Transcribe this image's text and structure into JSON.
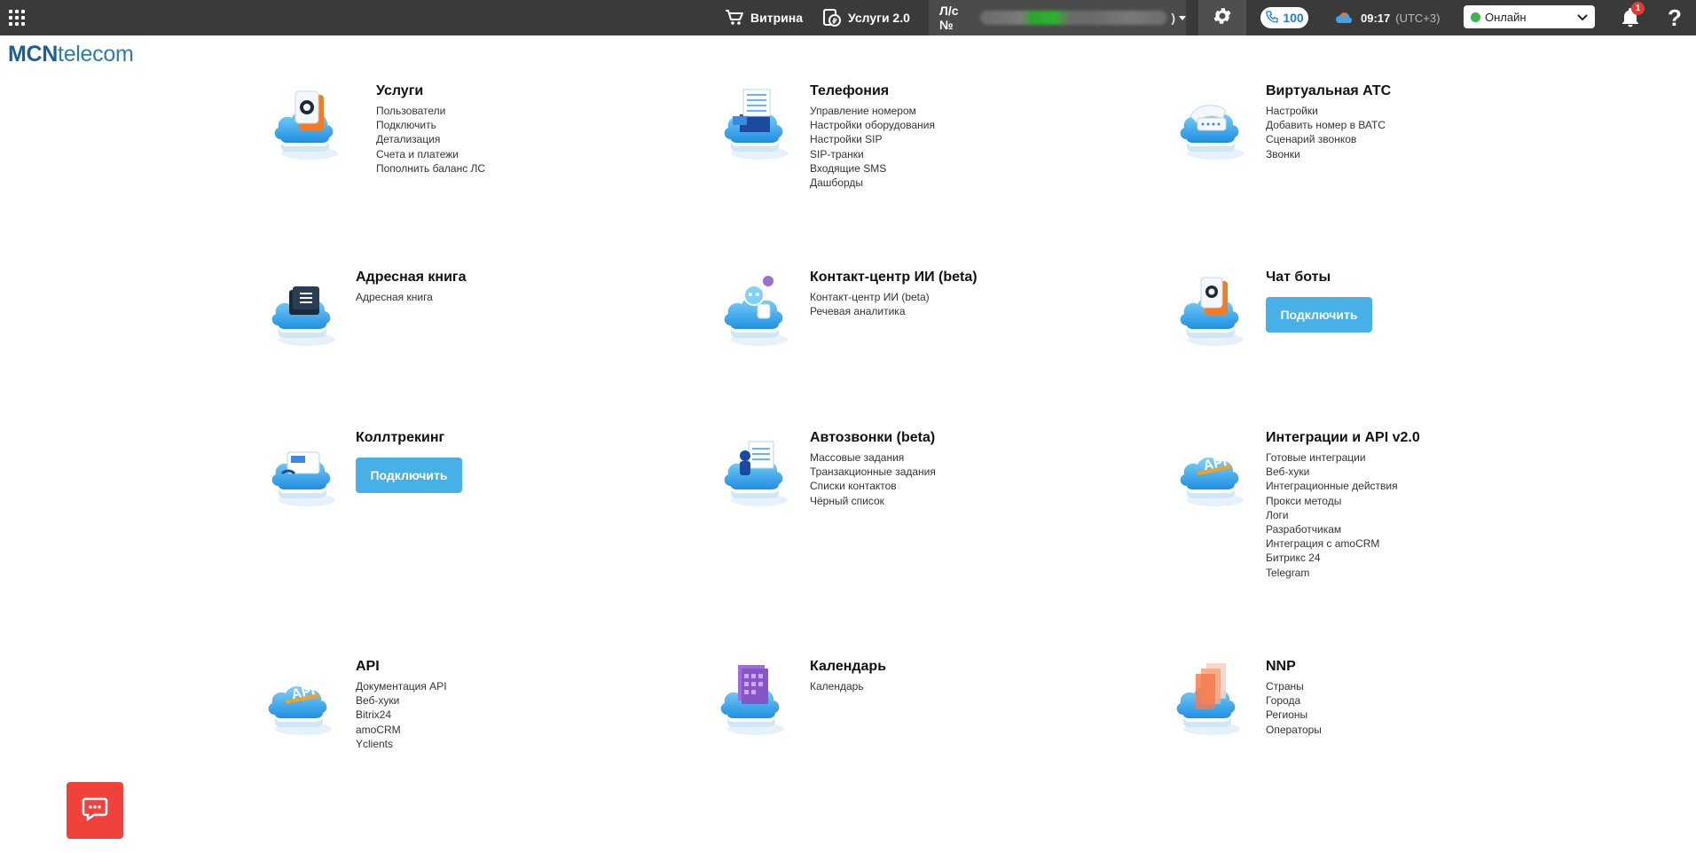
{
  "topbar": {
    "vitrina_label": "Витрина",
    "services2_label": "Услуги 2.0",
    "account_prefix": "Л/с №",
    "account_suffix": ")",
    "calls_count": "100",
    "time": "09:17",
    "timezone": "(UTC+3)",
    "status": "Онлайн",
    "notifications_count": "1",
    "help_label": "?"
  },
  "logo": {
    "bold": "MCN",
    "rest": "telecom"
  },
  "sections": [
    {
      "id": "uslugi",
      "title": "Услуги",
      "links": [
        "Пользователи",
        "Подключить",
        "Детализация",
        "Счета и платежи",
        "Пополнить баланс ЛС"
      ]
    },
    {
      "id": "telephony",
      "title": "Телефония",
      "links": [
        "Управление номером",
        "Настройки оборудования",
        "Настройки SIP",
        "SIP-транки",
        "Входящие SMS",
        "Дашборды"
      ]
    },
    {
      "id": "vats",
      "title": "Виртуальная АТС",
      "links": [
        "Настройки",
        "Добавить номер в ВАТС",
        "Сценарий звонков",
        "Звонки"
      ]
    },
    {
      "id": "addressbook",
      "title": "Адресная книга",
      "links": [
        "Адресная книга"
      ]
    },
    {
      "id": "contactcenter",
      "title": "Контакт-центр ИИ (beta)",
      "links": [
        "Контакт-центр ИИ (beta)",
        "Речевая аналитика"
      ]
    },
    {
      "id": "chatbots",
      "title": "Чат боты",
      "button": "Подключить"
    },
    {
      "id": "calltracking",
      "title": "Коллтрекинг",
      "button": "Подключить"
    },
    {
      "id": "autocalls",
      "title": "Автозвонки (beta)",
      "links": [
        "Массовые задания",
        "Транзакционные задания",
        "Списки контактов",
        "Чёрный список"
      ]
    },
    {
      "id": "integrations",
      "title": "Интеграции и API v2.0",
      "links": [
        "Готовые интеграции",
        "Веб-хуки",
        "Интеграционные действия",
        "Прокси методы",
        "Логи",
        "Разработчикам",
        "Интеграция с amoCRM",
        "Битрикс 24",
        "Telegram"
      ]
    },
    {
      "id": "api",
      "title": "API",
      "links": [
        "Документация API",
        "Веб-хуки",
        "Bitrix24",
        "amoCRM",
        "Yclients"
      ]
    },
    {
      "id": "calendar",
      "title": "Календарь",
      "links": [
        "Календарь"
      ]
    },
    {
      "id": "nnp",
      "title": "NNP",
      "links": [
        "Страны",
        "Города",
        "Регионы",
        "Операторы"
      ]
    }
  ],
  "icons": {
    "uslugi": "cloud-chat-icon",
    "telephony": "cloud-server-icon",
    "vats": "cloud-phone-icon",
    "addressbook": "cloud-book-icon",
    "contactcenter": "cloud-robot-icon",
    "chatbots": "cloud-chat-icon",
    "calltracking": "cloud-tracker-icon",
    "autocalls": "cloud-robot-icon",
    "integrations": "cloud-api-icon",
    "api": "cloud-api-icon",
    "calendar": "cloud-calendar-icon",
    "nnp": "cloud-layers-icon"
  },
  "colors": {
    "topbar": "#3a3a3a",
    "accent": "#47b0e6",
    "brand": "#2d7bb5",
    "chat_button": "#f0413a",
    "online": "#3bb54a"
  }
}
